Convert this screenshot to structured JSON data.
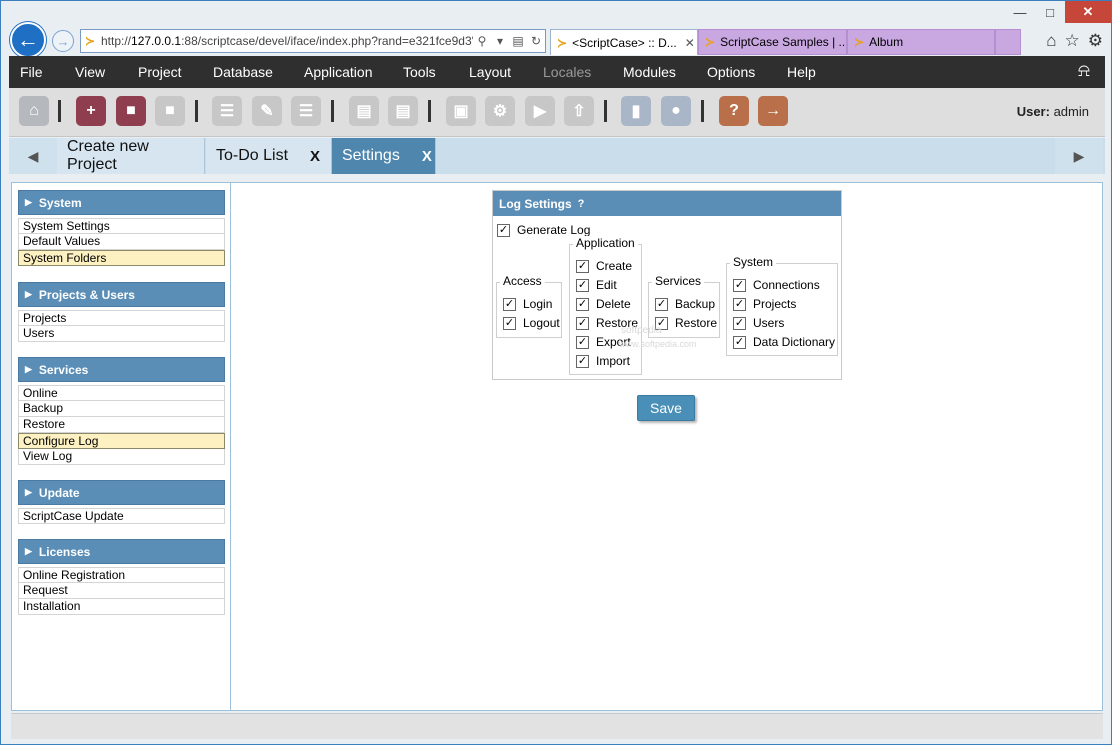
{
  "browser": {
    "address_scheme": "http://",
    "address_host": "127.0.0.1",
    "address_path": ":88/scriptcase/devel/iface/index.php?rand=e321fce9d3'",
    "tabs": [
      {
        "label": "<ScriptCase> :: D...",
        "close": "✕",
        "active": true
      },
      {
        "label": "ScriptCase Samples | ...",
        "active": false
      },
      {
        "label": "Album",
        "active": false
      }
    ],
    "colors": {
      "accent": "#1f6fc5",
      "tab_inactive": "#c9a7e0",
      "close_button": "#c7463a"
    }
  },
  "menu": {
    "items": [
      "File",
      "View",
      "Project",
      "Database",
      "Application",
      "Tools",
      "Layout",
      "Locales",
      "Modules",
      "Options",
      "Help"
    ]
  },
  "toolbar": {
    "icons": [
      "home-icon",
      "new-project-icon",
      "open-project-icon",
      "close-project-icon",
      "new-app-icon",
      "edit-app-icon",
      "list-apps-icon",
      "document-icon",
      "documents-icon",
      "save-icon",
      "generate-icon",
      "run-icon",
      "export-icon",
      "book-icon",
      "spell-check-icon",
      "help-icon",
      "exit-icon"
    ],
    "user_label": "User:",
    "user_name": "admin"
  },
  "app_tabs": [
    {
      "label": "Create new Project",
      "close": ""
    },
    {
      "label": "To-Do List",
      "close": "X"
    },
    {
      "label": "Settings",
      "close": "X",
      "active": true
    }
  ],
  "sidebar": {
    "groups": [
      {
        "title": "System",
        "items": [
          "System Settings",
          "Default Values",
          "System Folders"
        ],
        "selected": "System Folders"
      },
      {
        "title": "Projects & Users",
        "items": [
          "Projects",
          "Users"
        ]
      },
      {
        "title": "Services",
        "items": [
          "Online",
          "Backup",
          "Restore",
          "Configure Log",
          "View Log"
        ],
        "selected": "Configure Log"
      },
      {
        "title": "Update",
        "items": [
          "ScriptCase Update"
        ]
      },
      {
        "title": "Licenses",
        "items": [
          "Online Registration",
          "Request",
          "Installation"
        ]
      }
    ]
  },
  "log_settings": {
    "title": "Log Settings",
    "help": "?",
    "generate_log": {
      "label": "Generate Log",
      "checked": true
    },
    "access": {
      "legend": "Access",
      "items": [
        {
          "label": "Login",
          "checked": true
        },
        {
          "label": "Logout",
          "checked": true
        }
      ]
    },
    "application": {
      "legend": "Application",
      "items": [
        {
          "label": "Create",
          "checked": true
        },
        {
          "label": "Edit",
          "checked": true
        },
        {
          "label": "Delete",
          "checked": true
        },
        {
          "label": "Restore",
          "checked": true
        },
        {
          "label": "Export",
          "checked": true
        },
        {
          "label": "Import",
          "checked": true
        }
      ]
    },
    "services": {
      "legend": "Services",
      "items": [
        {
          "label": "Backup",
          "checked": true
        },
        {
          "label": "Restore",
          "checked": true
        }
      ]
    },
    "system": {
      "legend": "System",
      "items": [
        {
          "label": "Connections",
          "checked": true
        },
        {
          "label": "Projects",
          "checked": true
        },
        {
          "label": "Users",
          "checked": true
        },
        {
          "label": "Data Dictionary",
          "checked": true
        }
      ]
    },
    "save_label": "Save"
  },
  "watermark": [
    "softpedia",
    "www.softpedia.com"
  ]
}
